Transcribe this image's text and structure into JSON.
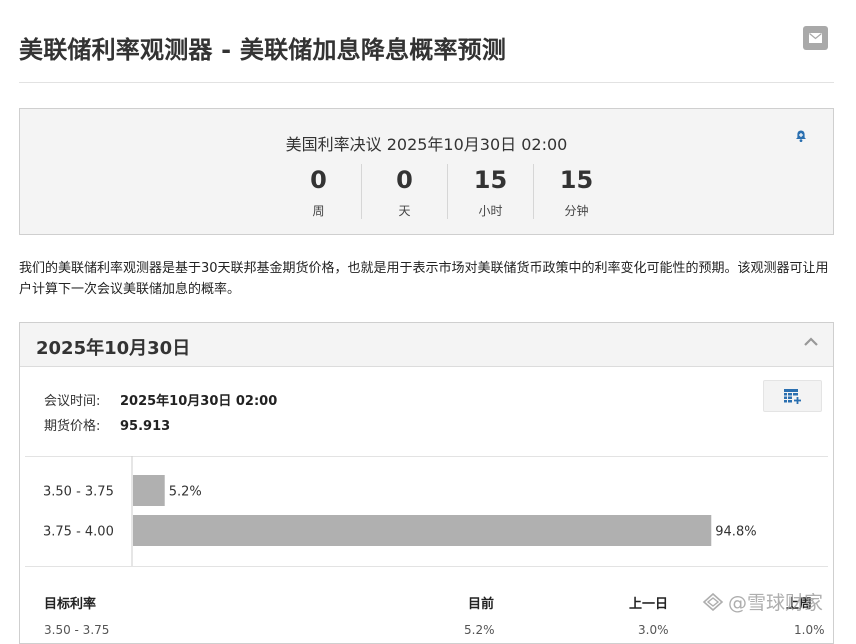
{
  "page": {
    "title": "美联储利率观测器 - 美联储加息降息概率预测"
  },
  "icons": {
    "mail": "envelope-icon",
    "bell": "bell-plus-icon",
    "chevron": "chevron-up-icon",
    "table_add": "table-add-icon",
    "watermark_logo": "diamond-logo-icon"
  },
  "countdown": {
    "title": "美国利率决议 2025年10月30日 02:00",
    "units": [
      {
        "value": "0",
        "label": "周"
      },
      {
        "value": "0",
        "label": "天"
      },
      {
        "value": "15",
        "label": "小时"
      },
      {
        "value": "15",
        "label": "分钟"
      }
    ]
  },
  "description": "我们的美联储利率观测器是基于30天联邦基金期货价格，也就是用于表示市场对美联储货币政策中的利率变化可能性的预期。该观测器可让用户计算下一次会议美联储加息的概率。",
  "meeting": {
    "date": "2025年10月30日",
    "time_label": "会议时间:",
    "time_value": "2025年10月30日 02:00",
    "price_label": "期货价格:",
    "price_value": "95.913"
  },
  "chart_data": {
    "type": "bar",
    "orientation": "horizontal",
    "categories": [
      "3.50 - 3.75",
      "3.75 - 4.00"
    ],
    "values": [
      5.2,
      94.8
    ],
    "value_labels": [
      "5.2%",
      "94.8%"
    ],
    "bar_color": "#b0b0b0",
    "xlim": [
      0,
      100
    ]
  },
  "table": {
    "headers": [
      "目标利率",
      "目前",
      "上一日",
      "上周"
    ],
    "partial_row": [
      "3.50 - 3.75",
      "5.2%",
      "3.0%",
      "1.0%"
    ]
  },
  "watermark": {
    "text": "@雪球财家"
  },
  "colors": {
    "panel_bg": "#f4f4f4",
    "border": "#cfcfcf",
    "icon_blue": "#2a6fb0"
  }
}
